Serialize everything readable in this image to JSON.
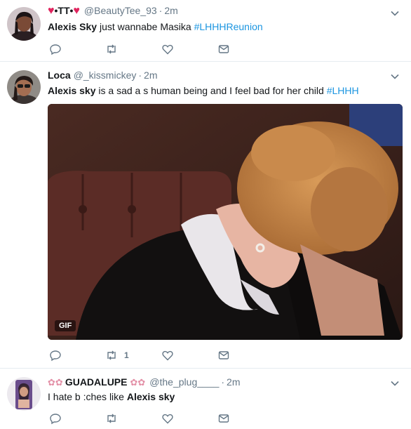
{
  "tweets": [
    {
      "display_name": "•TT•",
      "handle": "@BeautyTee_93",
      "time": "2m",
      "text": {
        "part1": "Alexis Sky",
        "part2": " just wannabe Masika ",
        "hashtag": "#LHHHReunion"
      },
      "actions": {
        "retweet_count": "",
        "like_count": ""
      }
    },
    {
      "display_name": "Loca",
      "handle": "@_kissmickey",
      "time": "2m",
      "text": {
        "part1": "Alexis sky",
        "part2": " is a sad a  s human being and I feel bad for her child  ",
        "hashtag": "#LHHH"
      },
      "media": {
        "type": "gif",
        "badge": "GIF"
      },
      "actions": {
        "retweet_count": "1",
        "like_count": ""
      }
    },
    {
      "display_name": "GUADALUPE",
      "handle": "@the_plug____",
      "time": "2m",
      "text": {
        "part1": "I hate b  :ches like ",
        "part2": "Alexis sky"
      },
      "actions": {
        "retweet_count": "",
        "like_count": ""
      }
    }
  ],
  "icons": {
    "reply": "reply-icon",
    "retweet": "retweet-icon",
    "like": "like-icon",
    "message": "direct-message-icon",
    "caret": "chevron-down-icon"
  },
  "colors": {
    "link": "#1b95e0",
    "secondary_text": "#657786",
    "heart": "#e0245e",
    "divider": "#e6ecf0"
  }
}
